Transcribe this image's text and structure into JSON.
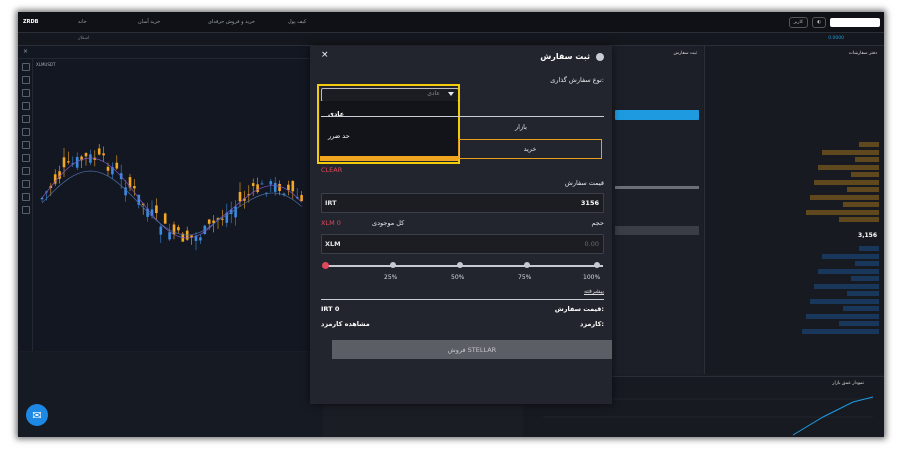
{
  "topbar": {
    "logo": "ZRDB",
    "nav": [
      "خانه",
      "خرید و فروش حرفه‌ای",
      "خرید آسان",
      "کیف پول"
    ],
    "right_pill": "کاربر"
  },
  "subbar": {
    "pair": "استلار",
    "rate": "0.0000"
  },
  "chart": {
    "symbol": "XLMUSDT",
    "tools_count": 14
  },
  "modal": {
    "title": "ثبت سفارش",
    "close": "×",
    "order_type_label": "نوع سفارش گذاری:",
    "order_type_value": "عادی",
    "dropdown_options": [
      "عادی",
      "حد ضرر"
    ],
    "tab_market": "بازار",
    "buy_label": "خرید",
    "clear": "CLEAR",
    "price_label": "قیمت سفارش",
    "price_unit": "IRT",
    "price_value": "3156",
    "volume_label": "حجم",
    "balance_label": "کل موجودی",
    "balance_value": "XLM 0",
    "volume_unit": "XLM",
    "volume_placeholder": "0.00",
    "slider_ticks": [
      "25%",
      "50%",
      "75%",
      "100%"
    ],
    "advanced": "پیشرفته",
    "order_price_label": "قیمت سفارش:",
    "order_price_value": "IRT 0",
    "fee_label": "کارمزد:",
    "fee_value": "مشاهده کارمزد",
    "sell_button": "فروش STELLAR"
  },
  "orderbook": {
    "price_mid": "3,156",
    "title": "دفتر سفارشات"
  },
  "right_form": {
    "title": "ثبت سفارش",
    "buy": "خرید"
  },
  "bottom_right": {
    "title": "نمودار عمق بازار"
  },
  "colors": {
    "accent": "#f2cc0a",
    "buy": "#e8a019",
    "sell": "#5b5e65",
    "blue": "#1e9be0",
    "red": "#e0485c"
  }
}
